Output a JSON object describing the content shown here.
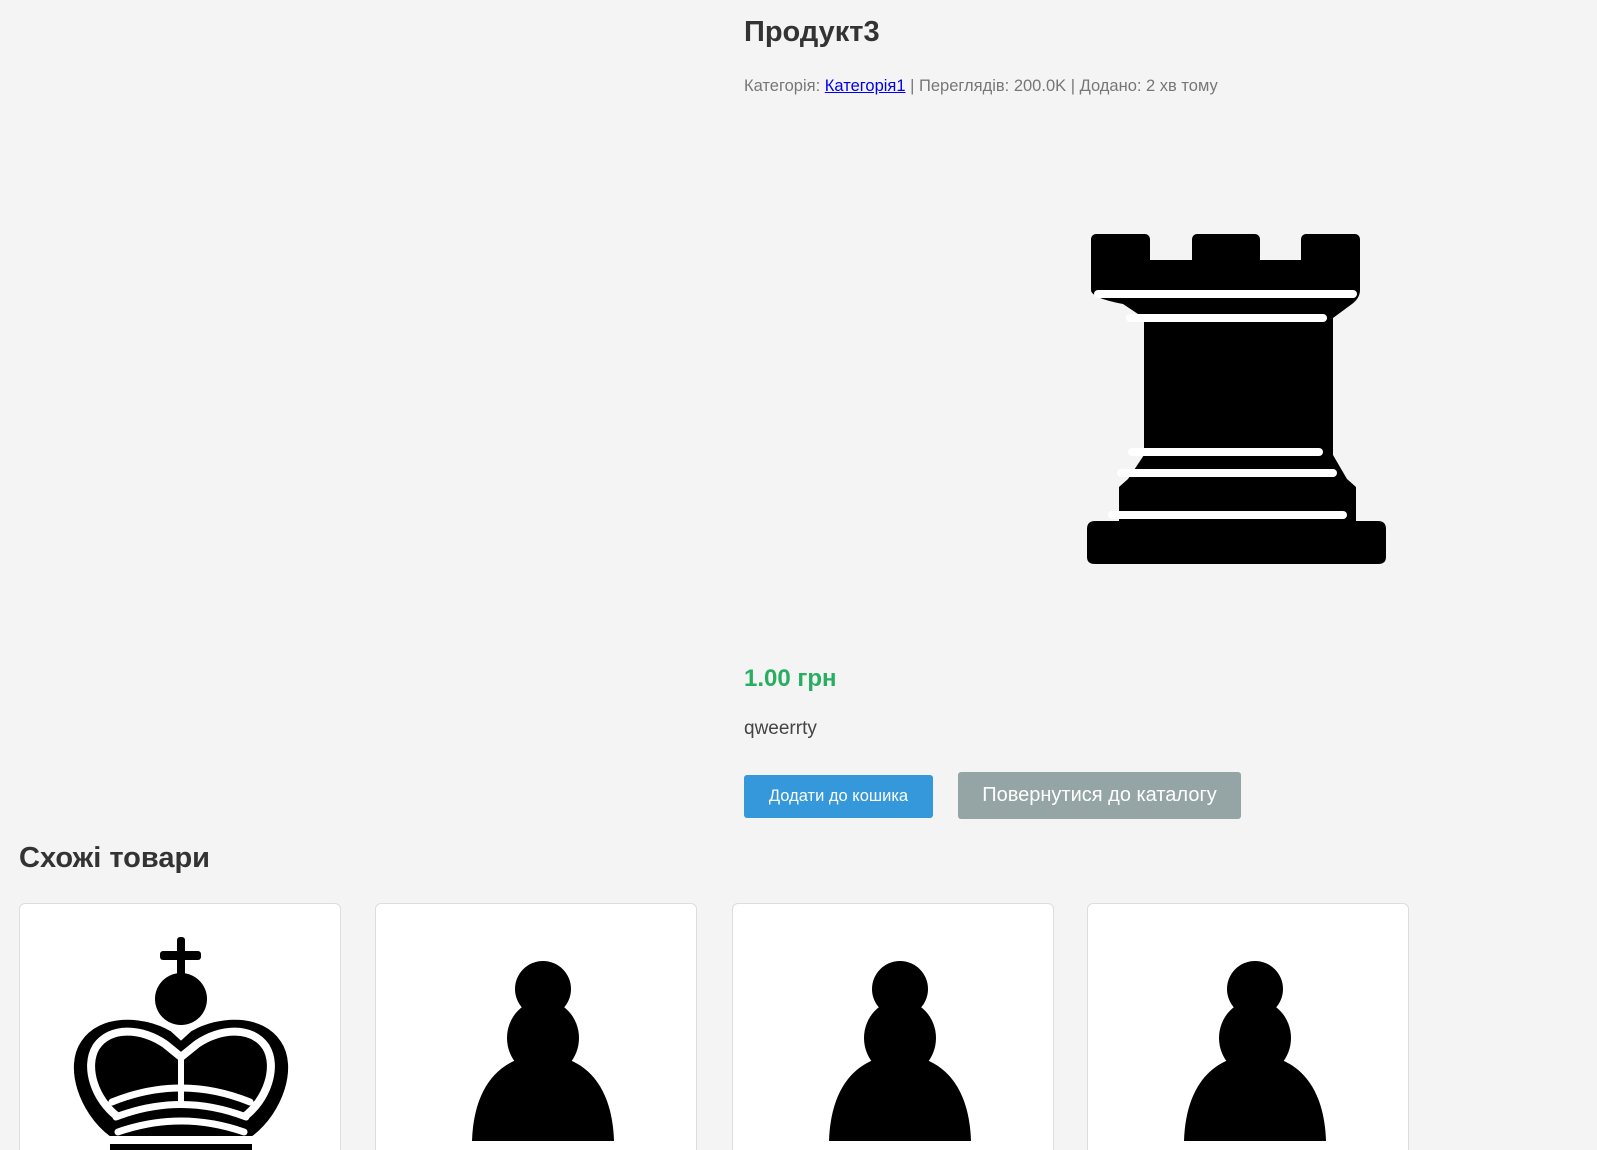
{
  "product": {
    "title": "Продукт3",
    "meta": {
      "category_prefix": "Категорія:",
      "category_link": "Категорія1",
      "views_text": "| Переглядів: 200.0K",
      "added_text": "| Додано: 2 хв тому"
    },
    "image_icon": "chess-rook-icon",
    "price": "1.00 грн",
    "description": "qweerrty"
  },
  "actions": {
    "add_to_cart": "Додати до кошика",
    "back_to_catalog": "Повернутися до каталогу"
  },
  "similar": {
    "title": "Схожі товари",
    "items": [
      {
        "icon": "chess-king-icon"
      },
      {
        "icon": "chess-pawn-icon"
      },
      {
        "icon": "chess-pawn-icon"
      },
      {
        "icon": "chess-pawn-icon"
      }
    ]
  },
  "colors": {
    "background": "#f4f4f4",
    "price": "#27ae60",
    "primary_button": "#3498db",
    "secondary_button": "#95a5a6",
    "link": "#0000ee"
  }
}
